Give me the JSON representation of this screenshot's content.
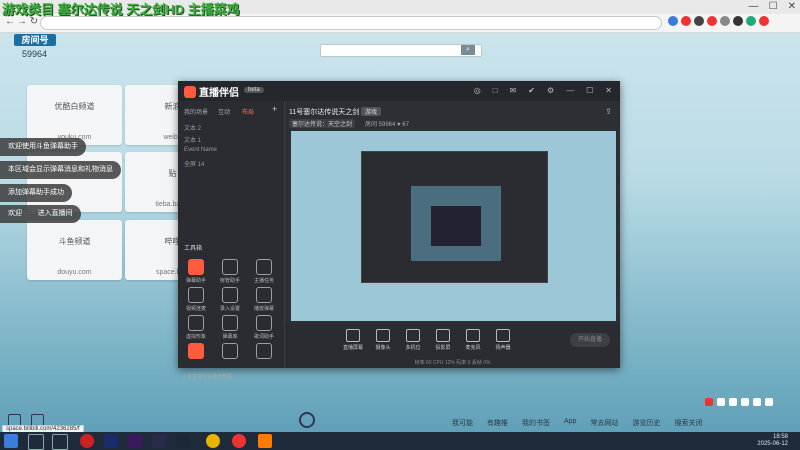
{
  "browser": {
    "overlay_title": "游戏类目 塞尔达传说 天之剑HD 主播菜鸡",
    "controls": [
      "—",
      "☐",
      "✕"
    ]
  },
  "room": {
    "label": "房间号",
    "number": "59964"
  },
  "search": {
    "placeholder": ""
  },
  "tiles": [
    {
      "name": "优酷白频道",
      "url": "youku.com"
    },
    {
      "name": "新浪",
      "url": "weibo"
    },
    {
      "name": "",
      "url": ""
    },
    {
      "name": "贴",
      "url": "tieba.baidu"
    },
    {
      "name": "斗鱼频道",
      "url": "douyu.com"
    },
    {
      "name": "哔哩",
      "url": "space.bilib"
    }
  ],
  "chat": [
    {
      "text": "欢迎使用斗鱼弹幕助手"
    },
    {
      "text": "本区域会显示弹幕消息和礼物消息"
    },
    {
      "text": "添加弹幕助手成功"
    },
    {
      "pre": "欢迎",
      "name": "·····",
      "post": " 进入直播间"
    }
  ],
  "app": {
    "logo": "直播伴侣",
    "version": "beta",
    "controls": [
      "◎",
      "□",
      "✉",
      "✔",
      "⚙",
      "—",
      "☐",
      "✕"
    ],
    "sidebar_tabs": [
      "我的场景",
      "互动",
      "布局"
    ],
    "scenes": [
      "文本 2",
      "文本 1",
      "Event Name",
      "全屏 14"
    ],
    "tools_title": "工具箱",
    "tools": [
      "弹幕助手",
      "房管助手",
      "主播任务",
      "视频连麦",
      "录入设置",
      "播放弹幕",
      "虚拟形象",
      "弹幕库",
      "歌词助手",
      "",
      "",
      ""
    ],
    "footer_note": "斗鱼直播伴侣使用教程",
    "stream": {
      "title": "11号塞尔达传说天之剑",
      "tag": "游戏",
      "category": "塞尔达传说：天空之剑",
      "stats": "房间 59964  ♥ 67"
    },
    "bottom_bar": [
      "直播屏幕",
      "摄像头",
      "多机位",
      "投影屏",
      "麦克风",
      "扬声器"
    ],
    "start_live": "开始直播",
    "status": "帧率 60   CPU 12%   码率 0   丢帧 0%"
  },
  "url_tip": "space.bilibili.com/4236285/f",
  "site_nav": [
    "我可能",
    "有趣推",
    "我的书签",
    "App",
    "常去网站",
    "游览历史",
    "搜索关闭"
  ],
  "clock": {
    "time": "18:58",
    "date": "2025-06-12"
  },
  "colors": {
    "accent": "#ff5b3c",
    "taskbar": "#1f2b3a",
    "room_badge": "#1c6ea3"
  }
}
